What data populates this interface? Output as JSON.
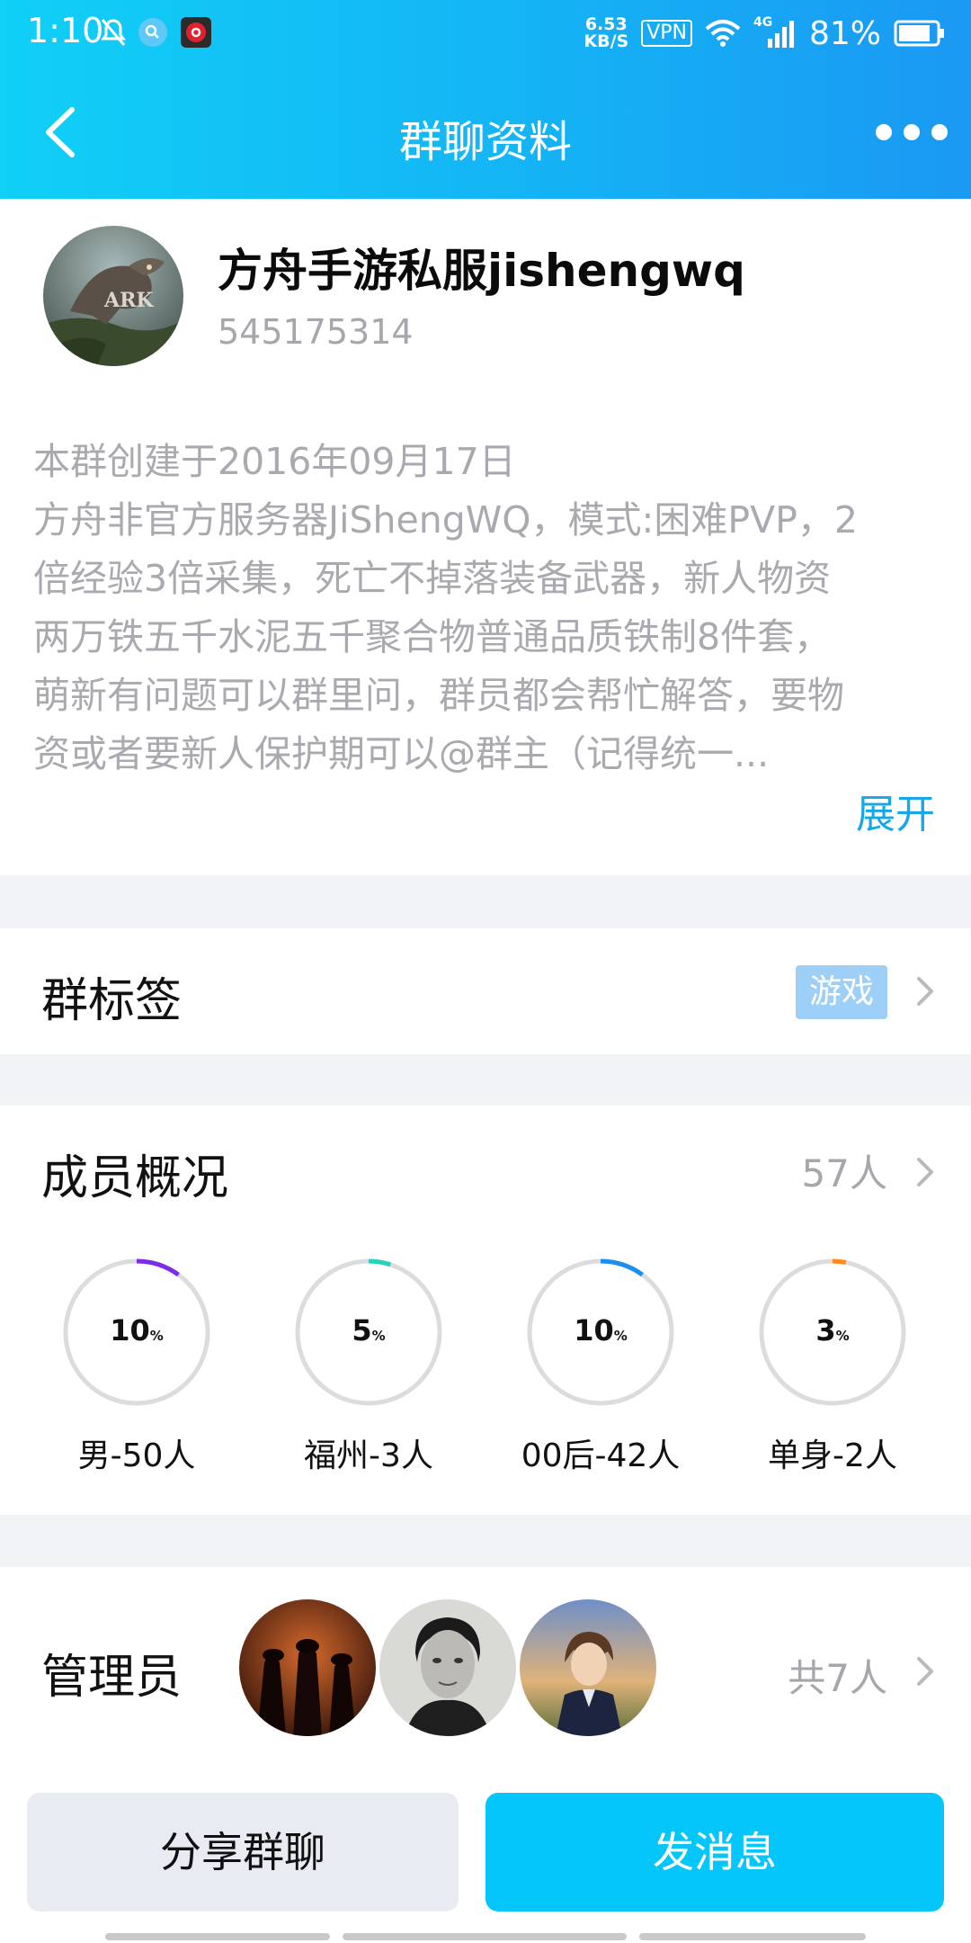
{
  "status_bar": {
    "time": "1:10",
    "net_speed_value": "6.53",
    "net_speed_unit": "KB/S",
    "vpn": "VPN",
    "network": "4G",
    "battery": "81%",
    "icons": [
      "mute-bell-icon",
      "search-app-icon",
      "netease-music-icon",
      "wifi-icon",
      "signal-icon",
      "battery-icon"
    ]
  },
  "header": {
    "title": "群聊资料",
    "back_icon": "chevron-left-icon",
    "more_icon": "more-dots-icon"
  },
  "group": {
    "name": "方舟手游私服jishengwq",
    "id": "545175314",
    "description_lines": [
      "本群创建于2016年09月17日",
      "方舟非官方服务器JiShengWQ，模式:困难PVP，2",
      "倍经验3倍采集，死亡不掉落装备武器，新人物资",
      "两万铁五千水泥五千聚合物普通品质铁制8件套，",
      "萌新有问题可以群里问，群员都会帮忙解答，要物",
      "资或者要新人保护期可以@群主（记得统一..."
    ],
    "expand_label": "展开"
  },
  "tags": {
    "label": "群标签",
    "tag": "游戏"
  },
  "members": {
    "label": "成员概况",
    "count": "57人",
    "stats": [
      {
        "value": "10",
        "unit": "%",
        "label": "男-50人",
        "color": "#7b2ee6",
        "fraction": 0.1
      },
      {
        "value": "5",
        "unit": "%",
        "label": "福州-3人",
        "color": "#2ad1c0",
        "fraction": 0.05
      },
      {
        "value": "10",
        "unit": "%",
        "label": "00后-42人",
        "color": "#1a8ff0",
        "fraction": 0.1
      },
      {
        "value": "3",
        "unit": "%",
        "label": "单身-2人",
        "color": "#ff8a1a",
        "fraction": 0.03
      }
    ]
  },
  "admins": {
    "label": "管理员",
    "total": "共7人"
  },
  "actions": {
    "share": "分享群聊",
    "send": "发消息"
  }
}
